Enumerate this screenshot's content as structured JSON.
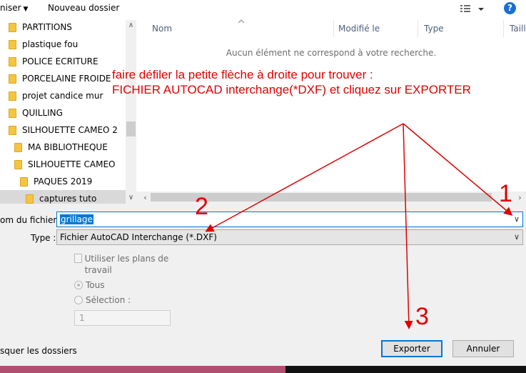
{
  "toolbar": {
    "organise_label": "niser",
    "new_folder_label": "Nouveau dossier",
    "help_label": "?"
  },
  "tree": {
    "items": [
      {
        "label": "PARTITIONS"
      },
      {
        "label": "plastique fou"
      },
      {
        "label": "POLICE ECRITURE"
      },
      {
        "label": "PORCELAINE FROIDE"
      },
      {
        "label": "projet candice mur"
      },
      {
        "label": "QUILLING"
      },
      {
        "label": "SILHOUETTE CAMEO 2"
      },
      {
        "label": "MA BIBLIOTHEQUE"
      },
      {
        "label": "SILHOUETTE CAMEO"
      },
      {
        "label": "PAQUES 2019"
      },
      {
        "label": "captures tuto"
      }
    ]
  },
  "filelist": {
    "columns": [
      "Nom",
      "Modifié le",
      "Type",
      "Taille"
    ],
    "empty_message": "Aucun élément ne correspond à votre recherche."
  },
  "form": {
    "filename_label": "om du fichier :",
    "filename_value": "grillage",
    "type_label": "Type :",
    "type_value": "Fichier AutoCAD Interchange (*.DXF)",
    "use_plans_label": "Utiliser les plans de travail",
    "all_label": "Tous",
    "selection_label": "Sélection :",
    "range_value": "1"
  },
  "footer": {
    "hide_folders_label": "squer les dossiers",
    "export_label": "Exporter",
    "cancel_label": "Annuler"
  },
  "annotation": {
    "line1": "faire défiler la petite flèche à droite pour trouver :",
    "line2": "FICHIER AUTOCAD interchange(*DXF) et cliquez sur EXPORTER",
    "num1": "1",
    "num2": "2",
    "num3": "3",
    "color": "#e00000"
  }
}
